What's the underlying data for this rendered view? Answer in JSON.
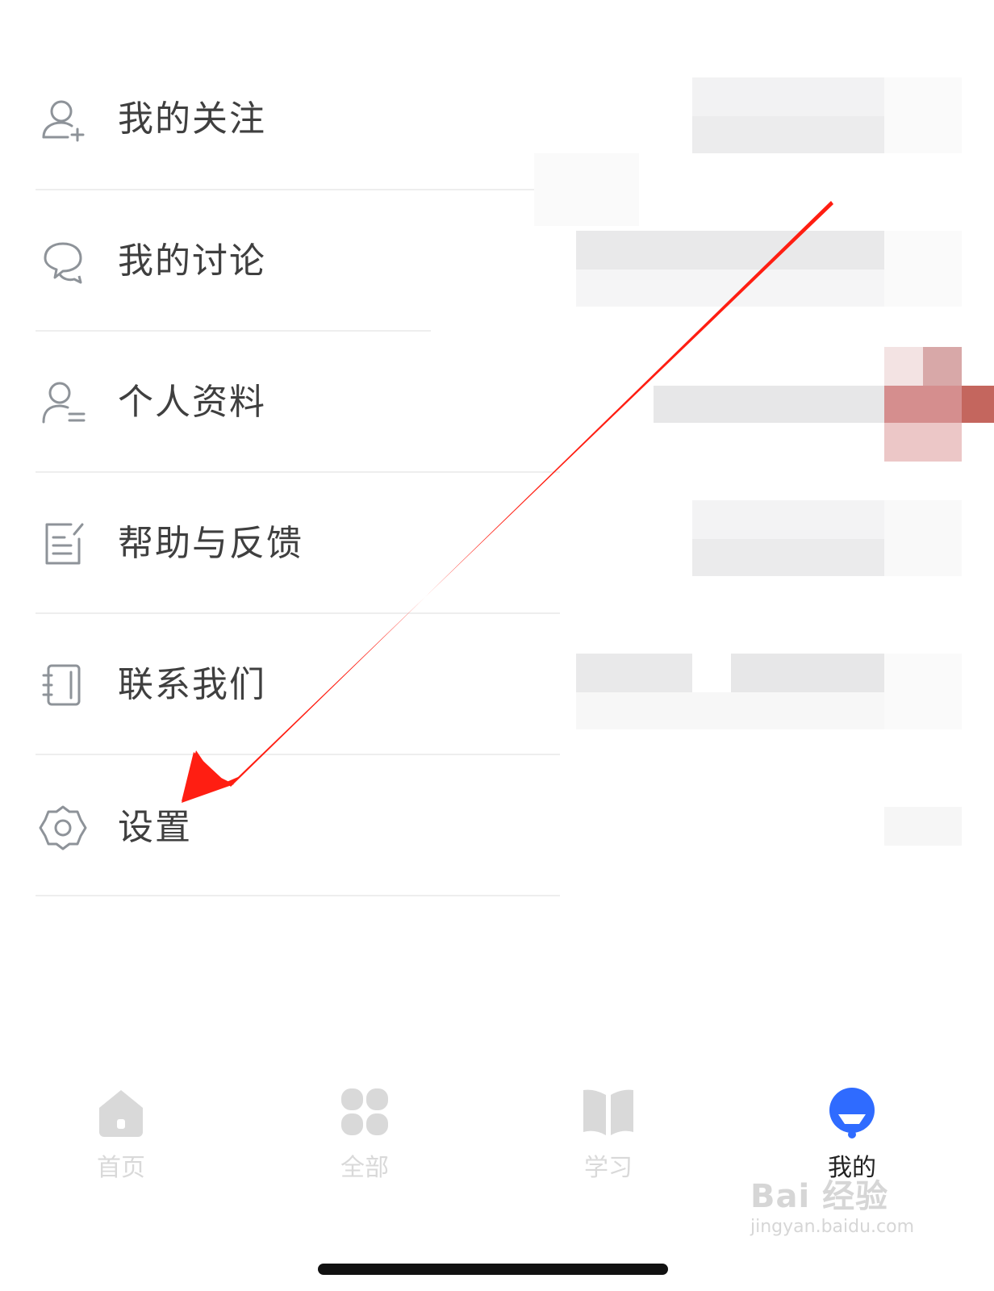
{
  "menu": {
    "items": [
      {
        "label": "我的关注",
        "icon": "user-follow-icon"
      },
      {
        "label": "我的讨论",
        "icon": "chat-bubbles-icon"
      },
      {
        "label": "个人资料",
        "icon": "user-profile-icon"
      },
      {
        "label": "帮助与反馈",
        "icon": "edit-feedback-icon"
      },
      {
        "label": "联系我们",
        "icon": "contact-book-icon"
      },
      {
        "label": "设置",
        "icon": "gear-icon"
      }
    ]
  },
  "tabbar": {
    "tabs": [
      {
        "label": "首页",
        "icon": "home-icon",
        "active": false
      },
      {
        "label": "全部",
        "icon": "grid-icon",
        "active": false
      },
      {
        "label": "学习",
        "icon": "book-icon",
        "active": false
      },
      {
        "label": "我的",
        "icon": "profile-avatar-icon",
        "active": true
      }
    ]
  },
  "colors": {
    "active": "#2f6bff",
    "inactive": "#d9d9d9",
    "text": "#3f3f3f",
    "arrow": "#ff1e12"
  },
  "watermark": {
    "main": "Bai 经验",
    "url": "jingyan.baidu.com"
  }
}
